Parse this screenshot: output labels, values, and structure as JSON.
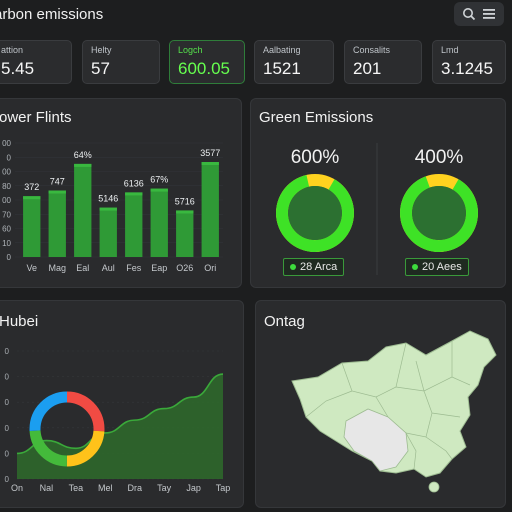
{
  "app_title": "arbon emissions",
  "toolbar": {
    "search_icon": "search-icon",
    "menu_icon": "menu-icon"
  },
  "stats": [
    {
      "label": "attion",
      "value": "5.45"
    },
    {
      "label": "Helty",
      "value": "57"
    },
    {
      "label": "Logch",
      "value": "600.05"
    },
    {
      "label": "Aalbating",
      "value": "1521"
    },
    {
      "label": "Consalits",
      "value": "201"
    },
    {
      "label": "Lmd",
      "value": "3.1245"
    }
  ],
  "panels": {
    "power": {
      "title": "ower Flints"
    },
    "green": {
      "title": "Green Emissions",
      "rings": [
        {
          "pct": "600%",
          "badge": "28 Arca",
          "green_fraction": 0.88
        },
        {
          "pct": "400%",
          "badge": "20 Aees",
          "green_fraction": 0.86
        }
      ]
    },
    "hubei": {
      "title": "Hubei"
    },
    "map": {
      "title": "Ontag"
    }
  },
  "chart_data": [
    {
      "type": "bar",
      "title": "ower Flints",
      "categories": [
        "Ve",
        "Mag",
        "Eal",
        "Aul",
        "Fes",
        "Eap",
        "O26",
        "Ori"
      ],
      "values": [
        64,
        70,
        98,
        52,
        68,
        72,
        49,
        100
      ],
      "data_labels": [
        "372",
        "747",
        "64%",
        "5146",
        "6136",
        "67%",
        "5716",
        "3577"
      ],
      "y_ticks": [
        "00",
        "0",
        "00",
        "80",
        "00",
        "70",
        "60",
        "10",
        "0"
      ],
      "ylim": [
        0,
        120
      ],
      "colors": {
        "bar": "#2f9a36",
        "bar_top": "#39b83f"
      }
    },
    {
      "type": "area",
      "title": "Hubei",
      "categories": [
        "On",
        "Nal",
        "Tea",
        "Mel",
        "Dra",
        "Tay",
        "Jap",
        "Tap"
      ],
      "values": [
        20,
        30,
        24,
        36,
        46,
        55,
        64,
        82
      ],
      "y_ticks": [
        "0",
        "0",
        "0",
        "0",
        "0",
        "0"
      ],
      "ylim": [
        0,
        100
      ],
      "colors": {
        "fill": "#2e6b2c",
        "line": "#3aa93a"
      }
    },
    {
      "type": "pie",
      "slices": [
        {
          "value": 26,
          "color": "#f14b43"
        },
        {
          "value": 24,
          "color": "#ffc21a"
        },
        {
          "value": 24,
          "color": "#44ba3b"
        },
        {
          "value": 26,
          "color": "#1b9ef0"
        }
      ]
    }
  ],
  "map": {
    "region_count": 16,
    "colors": {
      "fill": "#cfe9c1",
      "muted": "#e7e7e7",
      "border": "#9dbb91"
    }
  }
}
